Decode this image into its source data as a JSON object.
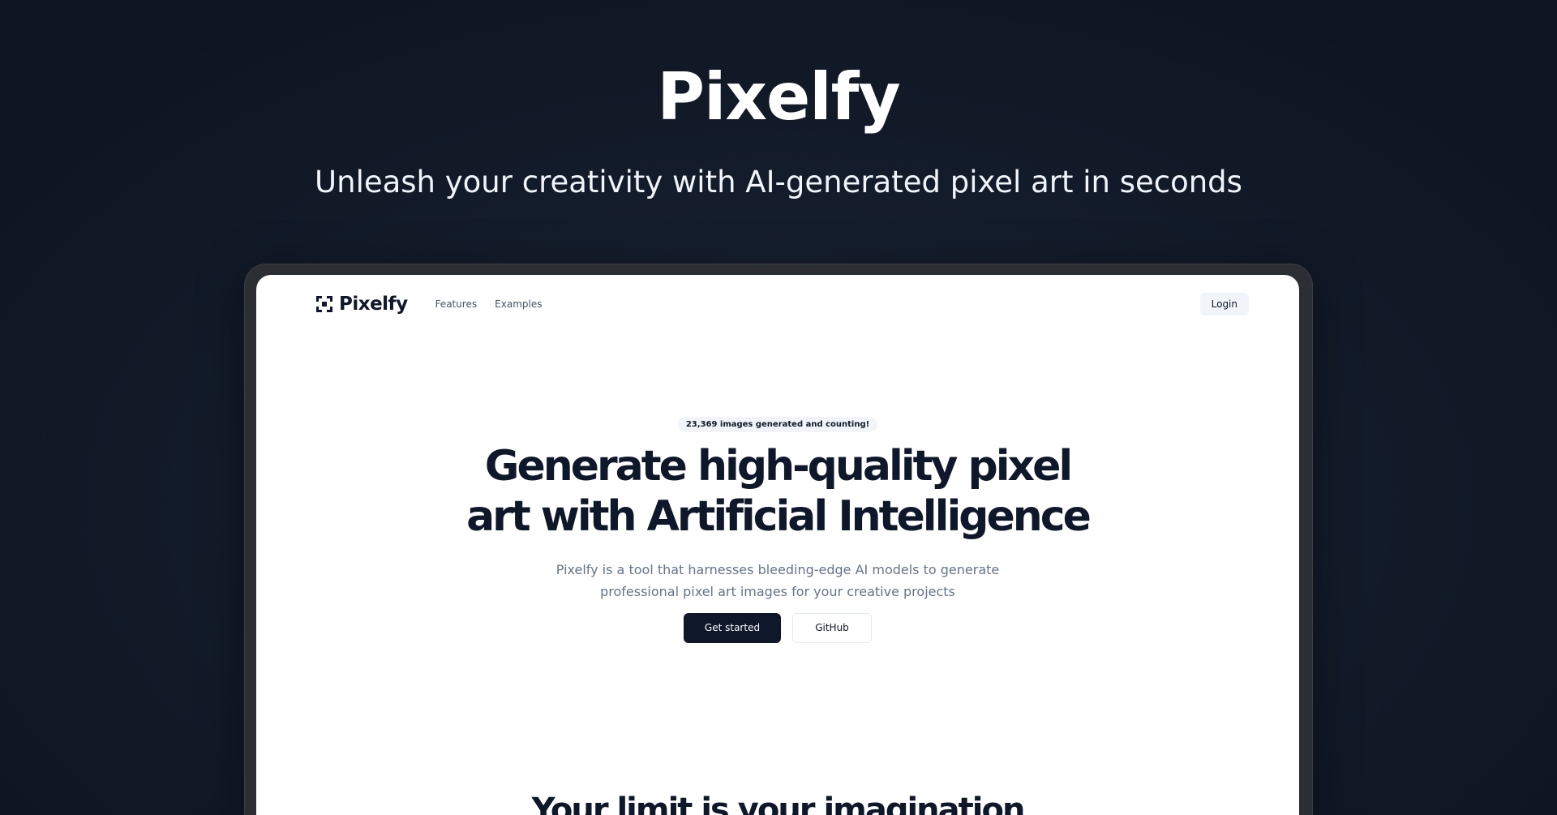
{
  "promo": {
    "title": "Pixelfy",
    "subtitle": "Unleash your creativity with AI-generated pixel art in seconds"
  },
  "nav": {
    "brand": "Pixelfy",
    "links": [
      "Features",
      "Examples"
    ],
    "login_label": "Login"
  },
  "hero": {
    "badge": "23,369 images generated and counting!",
    "headline_line1": "Generate high-quality pixel",
    "headline_line2": "art with Artificial Intelligence",
    "description_line1": "Pixelfy is a tool that harnesses bleeding-edge AI models to generate",
    "description_line2": "professional pixel art images for your creative projects",
    "primary_cta": "Get started",
    "secondary_cta": "GitHub"
  },
  "next_section": {
    "heading": "Your limit is your imagination"
  },
  "colors": {
    "background": "#141d2c",
    "accent_dark": "#0f172a",
    "muted_text": "#64748b",
    "badge_bg": "#f1f5f9"
  },
  "icons": {
    "logo": "pixel-frame-icon"
  }
}
